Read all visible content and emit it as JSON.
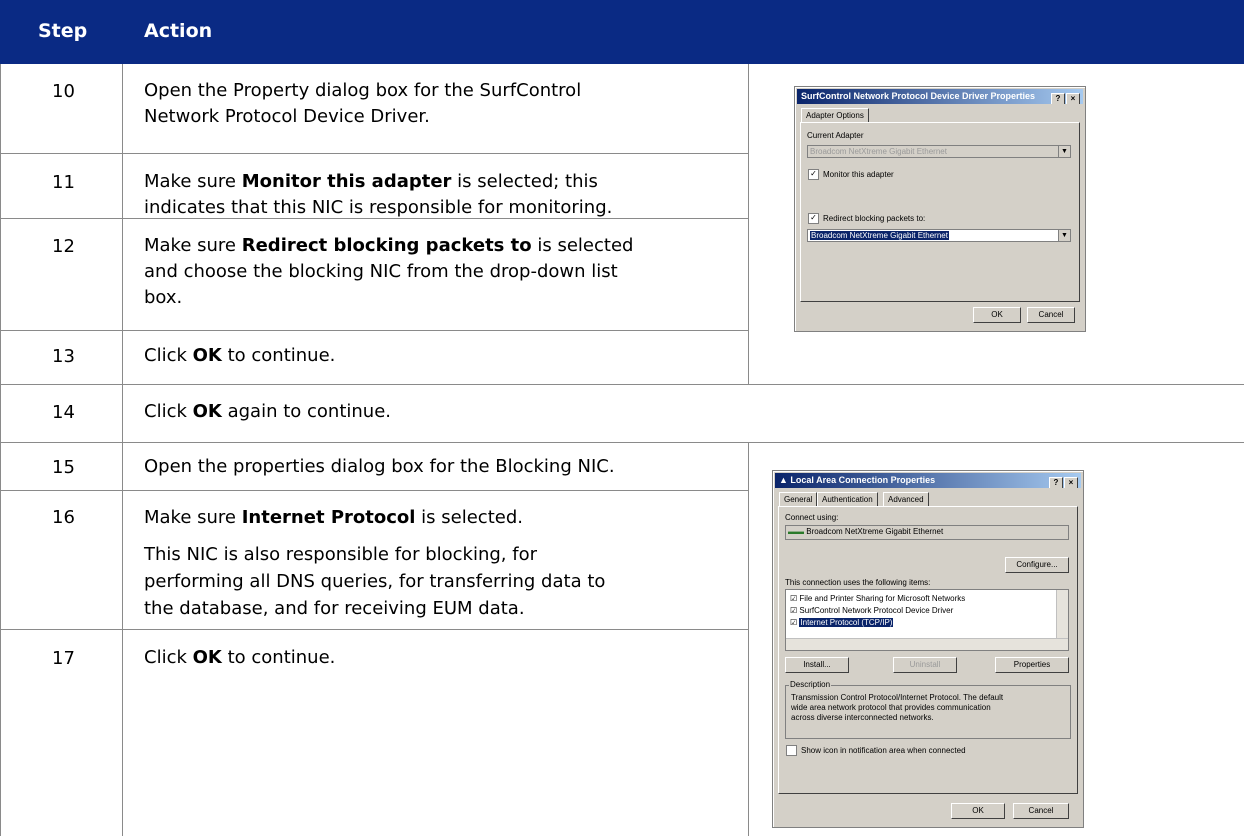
{
  "header": {
    "col_step": "Step",
    "col_action": "Action"
  },
  "rows": [
    {
      "step": "10",
      "lines": [
        [
          {
            "t": "Open the Property dialog box for the SurfControl",
            "b": false
          }
        ],
        [
          {
            "t": "Network Protocol Device Driver.",
            "b": false
          }
        ]
      ]
    },
    {
      "step": "11",
      "lines": [
        [
          {
            "t": "Make sure ",
            "b": false
          },
          {
            "t": "Monitor this adapter",
            "b": true
          },
          {
            "t": " is selected; this",
            "b": false
          }
        ],
        [
          {
            "t": "indicates that this NIC is responsible for monitoring.",
            "b": false
          }
        ]
      ]
    },
    {
      "step": "12",
      "lines": [
        [
          {
            "t": "Make sure ",
            "b": false
          },
          {
            "t": "Redirect blocking packets to",
            "b": true
          },
          {
            "t": " is selected",
            "b": false
          }
        ],
        [
          {
            "t": "and choose the blocking NIC from the drop-down list",
            "b": false
          }
        ],
        [
          {
            "t": "box.",
            "b": false
          }
        ]
      ]
    },
    {
      "step": "13",
      "lines": [
        [
          {
            "t": "Click ",
            "b": false
          },
          {
            "t": "OK",
            "b": true
          },
          {
            "t": " to continue.",
            "b": false
          }
        ]
      ]
    },
    {
      "step": "14",
      "lines": [
        [
          {
            "t": "Click ",
            "b": false
          },
          {
            "t": "OK",
            "b": true
          },
          {
            "t": " again to continue.",
            "b": false
          }
        ]
      ]
    },
    {
      "step": "15",
      "lines": [
        [
          {
            "t": "Open the properties dialog box for the Blocking NIC.",
            "b": false
          }
        ]
      ]
    },
    {
      "step": "16",
      "lines": [
        [
          {
            "t": "Make sure ",
            "b": false
          },
          {
            "t": "Internet Protocol",
            "b": true
          },
          {
            "t": " is selected.",
            "b": false
          }
        ],
        [],
        [
          {
            "t": "This NIC is also responsible for blocking, for",
            "b": false
          }
        ],
        [
          {
            "t": "performing all DNS queries, for transferring data to",
            "b": false
          }
        ],
        [
          {
            "t": "the database, and for receiving EUM data.",
            "b": false
          }
        ]
      ]
    },
    {
      "step": "17",
      "lines": [
        [
          {
            "t": "Click ",
            "b": false
          },
          {
            "t": "OK",
            "b": true
          },
          {
            "t": " to continue.",
            "b": false
          }
        ]
      ]
    }
  ],
  "dialog1": {
    "title": "SurfControl Network Protocol Device Driver Properties",
    "help": "?",
    "close": "×",
    "tab": "Adapter Options",
    "current_adapter_label": "Current Adapter",
    "current_adapter_value": "Broadcom NetXtreme Gigabit Ethernet",
    "monitor_label": "Monitor this adapter",
    "redirect_label": "Redirect blocking packets to:",
    "redirect_value": "Broadcom NetXtreme Gigabit Ethernet",
    "ok": "OK",
    "cancel": "Cancel"
  },
  "dialog2": {
    "title": "Local Area Connection Properties",
    "help": "?",
    "close": "×",
    "tabs": [
      "General",
      "Authentication",
      "Advanced"
    ],
    "connect_using_label": "Connect using:",
    "adapter": "Broadcom NetXtreme Gigabit Ethernet",
    "configure": "Configure...",
    "items_label": "This connection uses the following items:",
    "items": [
      "File and Printer Sharing for Microsoft Networks",
      "SurfControl Network Protocol Device Driver",
      "Internet Protocol (TCP/IP)"
    ],
    "install": "Install...",
    "uninstall": "Uninstall",
    "properties": "Properties",
    "description_label": "Description",
    "description": [
      "Transmission Control Protocol/Internet Protocol. The default",
      "wide area network protocol that provides communication",
      "across diverse interconnected networks."
    ],
    "show_icon": "Show icon in notification area when connected",
    "ok": "OK",
    "cancel": "Cancel"
  }
}
